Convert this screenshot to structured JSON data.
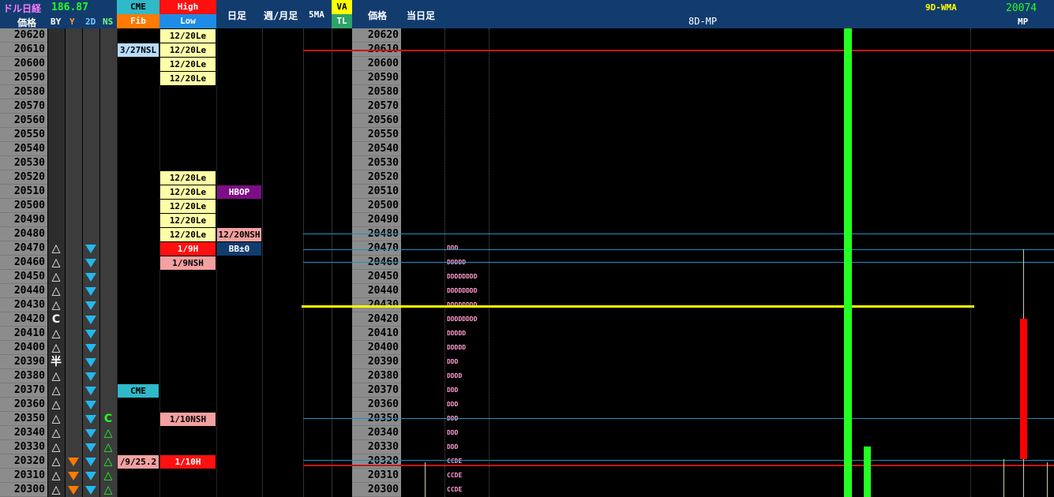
{
  "header": {
    "title": "ドル日経",
    "price_label": "価格",
    "value": "186.87",
    "by": "BY",
    "y": "Y",
    "two_d": "2D",
    "ns": "NS",
    "cme": "CME",
    "fib": "Fib",
    "high": "High",
    "low": "Low",
    "daily": "日足",
    "weekly_monthly": "週/月足",
    "five_ma": "5MA",
    "va": "VA",
    "tl": "TL",
    "price_label2": "価格",
    "today": "当日足",
    "eight_d_mp": "8D-MP",
    "nine_d_wma": "9D-WMA",
    "wma_value": "20074",
    "mp": "MP"
  },
  "prices": [
    "20620",
    "20610",
    "20600",
    "20590",
    "20580",
    "20570",
    "20560",
    "20550",
    "20540",
    "20530",
    "20520",
    "20510",
    "20500",
    "20490",
    "20480",
    "20470",
    "20460",
    "20450",
    "20440",
    "20430",
    "20420",
    "20410",
    "20400",
    "20390",
    "20380",
    "20370",
    "20360",
    "20350",
    "20340",
    "20330",
    "20320",
    "20310",
    "20300"
  ],
  "by_marks": {
    "r15": "△",
    "r16": "△",
    "r17": "△",
    "r18": "△",
    "r19": "△",
    "r20": "C",
    "r21": "△",
    "r22": "△",
    "r23": "半",
    "r24": "△",
    "r25": "△",
    "r26": "△",
    "r27": "△",
    "r28": "△",
    "r29": "△",
    "r30": "△",
    "r31": "△",
    "r32": "△"
  },
  "ns_marks": {
    "r27": "C",
    "r28": "△",
    "r29": "△",
    "r30": "△",
    "r31": "△",
    "r32": "△"
  },
  "cme_cells": {
    "r1": "3/27NSL",
    "r25": "CME",
    "r30": "/9/25.2"
  },
  "hl_cells": {
    "r0": "12/20Le",
    "r1": "12/20Le",
    "r2": "12/20Le",
    "r3": "12/20Le",
    "r10": "12/20Le",
    "r11": "12/20Le",
    "r12": "12/20Le",
    "r13": "12/20Le",
    "r14": "12/20Le",
    "r15": "1/9H",
    "r16": "1/9NSH",
    "r27": "1/10NSH",
    "r30": "1/10H"
  },
  "daily_cells": {
    "r11": "HBOP",
    "r14": "12/20NSH",
    "r15": "BB±0"
  },
  "mp_letters": {
    "r15": "DDD",
    "r16": "DDDDD",
    "r17": "DDDDDDDD",
    "r18": "DDDDDDDD",
    "r19": "DDDDDDDD",
    "r20": "DDDDDDDD",
    "r21": "DDDDD",
    "r22": "DDDDD",
    "r23": "DDD",
    "r24": "DDDD",
    "r25": "DDD",
    "r26": "DDD",
    "r27": "DDD",
    "r28": "DDD",
    "r29": "DDD",
    "r30": "CCDE",
    "r31": "CCDE",
    "r32": "CCDE"
  },
  "colors": {
    "header_bg": "#123c6e",
    "title": "#ff7cff",
    "value": "#23ff23",
    "yellow_text": "#ffff00",
    "red_line": "#c81414",
    "blue_line": "#1e90c8",
    "yellow_line": "#ffff00",
    "green_bar": "#23ff23",
    "red_bar": "#ff0000"
  }
}
